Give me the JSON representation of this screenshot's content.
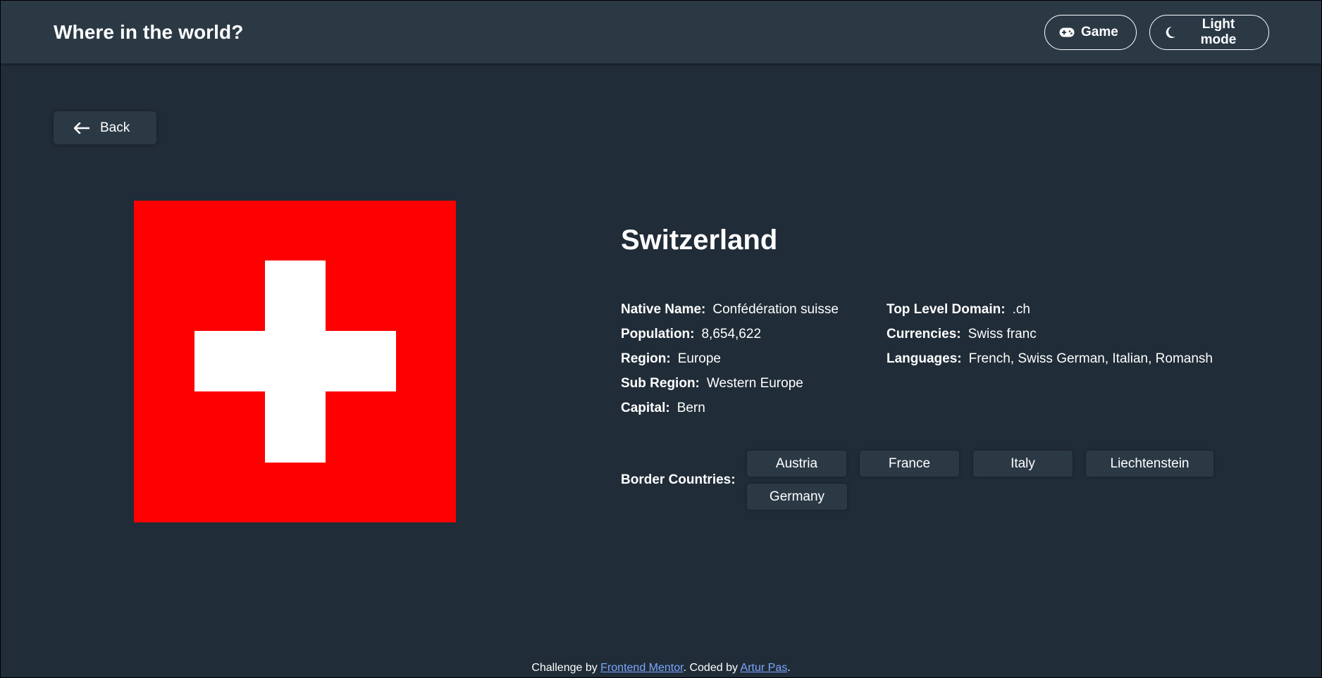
{
  "header": {
    "title": "Where in the world?",
    "game_label": "Game",
    "game_icon": "gamepad-icon",
    "mode_label": "Light mode",
    "mode_icon": "moon-icon"
  },
  "back": {
    "label": "Back",
    "icon": "arrow-left-icon"
  },
  "country": {
    "name": "Switzerland",
    "flag_colors": {
      "field": "#ff0000",
      "cross": "#ffffff"
    },
    "details_left": [
      {
        "label": "Native Name:",
        "value": "Confédération suisse"
      },
      {
        "label": "Population:",
        "value": "8,654,622"
      },
      {
        "label": "Region:",
        "value": "Europe"
      },
      {
        "label": "Sub Region:",
        "value": "Western Europe"
      },
      {
        "label": "Capital:",
        "value": "Bern"
      }
    ],
    "details_right": [
      {
        "label": "Top Level Domain:",
        "value": ".ch"
      },
      {
        "label": "Currencies:",
        "value": "Swiss franc"
      },
      {
        "label": "Languages:",
        "value": "French, Swiss German, Italian, Romansh"
      }
    ],
    "border_label": "Border Countries:",
    "borders": [
      "Austria",
      "France",
      "Italy",
      "Liechtenstein",
      "Germany"
    ]
  },
  "footer": {
    "prefix": "Challenge by ",
    "link1": "Frontend Mentor",
    "middle": ". Coded by ",
    "link2": "Artur Pas",
    "suffix": "."
  },
  "colors": {
    "background": "#202c37",
    "elements": "#2b3945",
    "text": "#ffffff",
    "link": "#7aa6ff"
  }
}
